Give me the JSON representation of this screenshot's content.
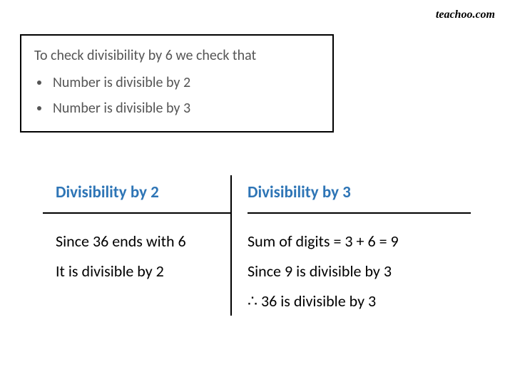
{
  "watermark": "teachoo.com",
  "rule": {
    "title": "To check divisibility by 6 we check that",
    "items": [
      "Number is divisible by 2",
      "Number is divisible by 3"
    ]
  },
  "table": {
    "left": {
      "header": "Divisibility by 2",
      "lines": [
        "Since 36 ends with 6",
        "It is divisible by 2"
      ]
    },
    "right": {
      "header": "Divisibility by 3",
      "lines": [
        "Sum of digits = 3 + 6 = 9",
        "Since 9 is divisible by 3",
        "∴ 36 is divisible  by 3"
      ]
    }
  }
}
